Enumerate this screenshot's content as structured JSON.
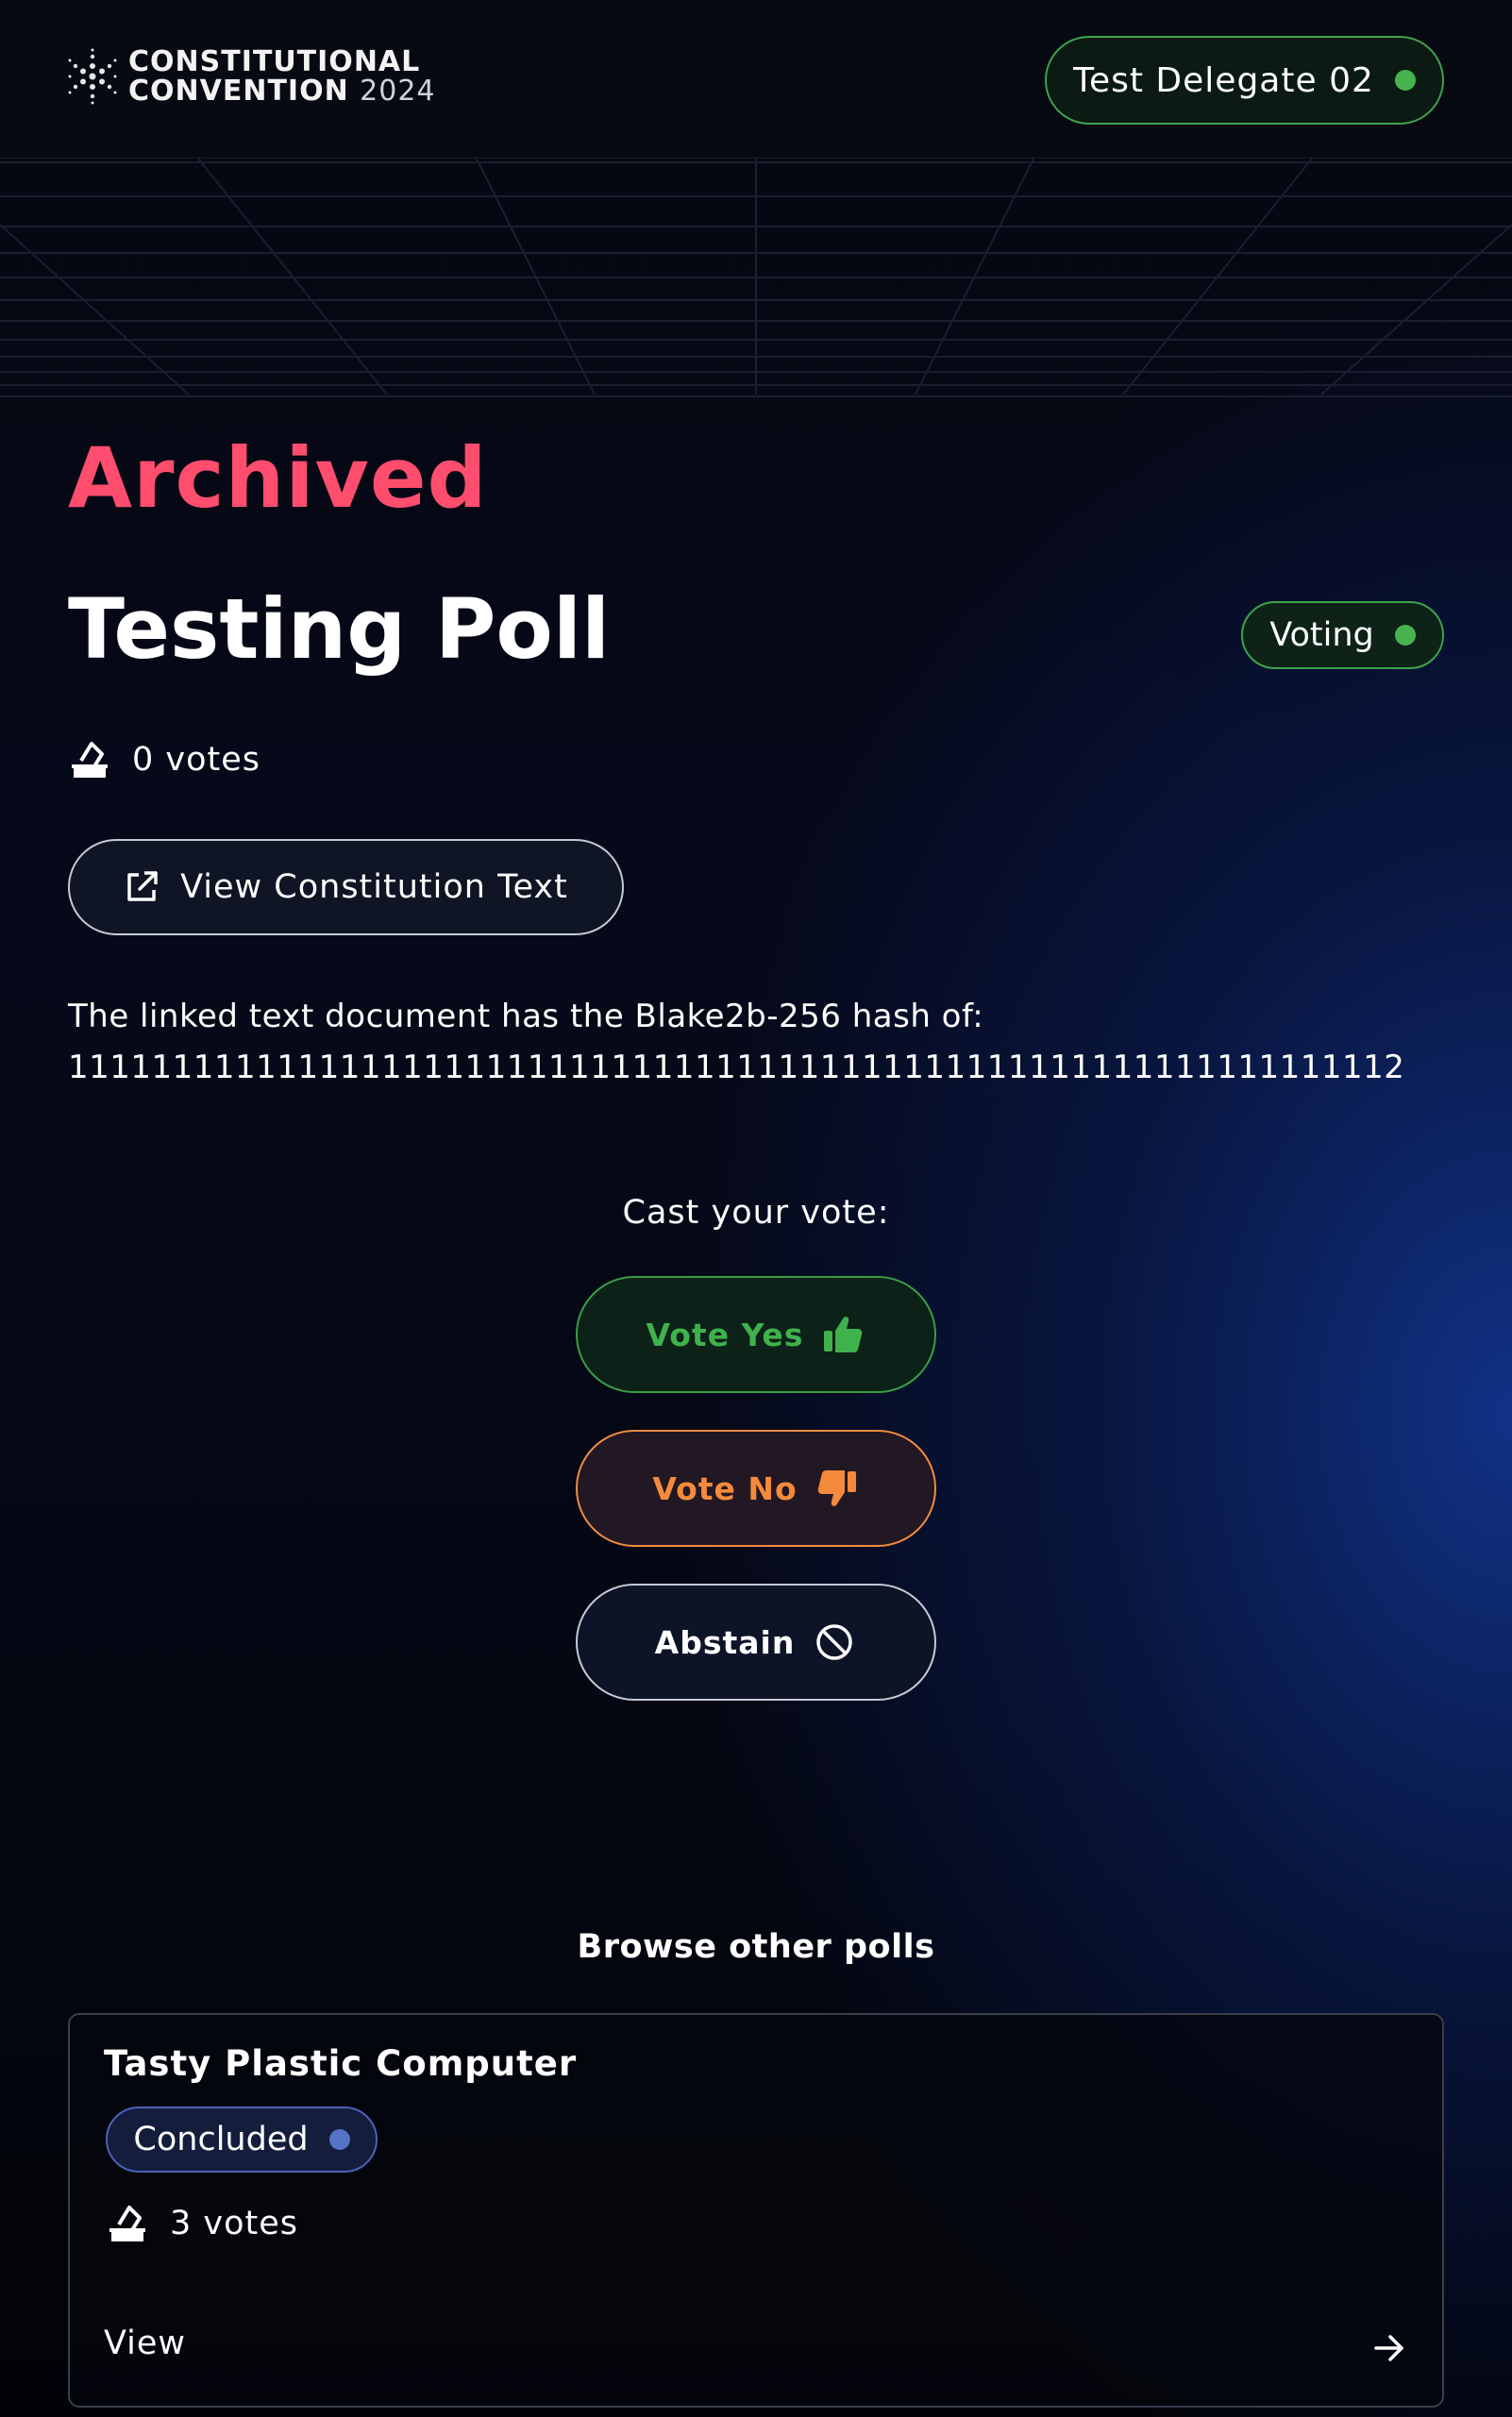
{
  "header": {
    "logo_line1": "CONSTITUTIONAL",
    "logo_line2": "CONVENTION",
    "logo_year": "2024",
    "user_label": "Test Delegate 02",
    "user_status_color": "#46b34f"
  },
  "poll": {
    "state_label": "Archived",
    "title": "Testing Poll",
    "status": "Voting",
    "votes_count": "0",
    "votes_unit": "votes",
    "view_constitution_label": "View Constitution Text",
    "hash_intro": "The linked text document has the Blake2b-256 hash of:",
    "hash_value": "1111111111111111111111111111111111111111111111111111111111111112"
  },
  "voting": {
    "prompt": "Cast your vote:",
    "yes_label": "Vote Yes",
    "no_label": "Vote No",
    "abstain_label": "Abstain"
  },
  "browse": {
    "heading": "Browse other polls",
    "polls": [
      {
        "title": "Tasty Plastic Computer",
        "status": "Concluded",
        "votes_count": "3",
        "votes_unit": "votes",
        "view_label": "View"
      }
    ]
  },
  "colors": {
    "archived": "#ff4d6d",
    "voting_green": "#46b34f",
    "vote_no_orange": "#f48a3c",
    "concluded_blue": "#5673c6"
  }
}
